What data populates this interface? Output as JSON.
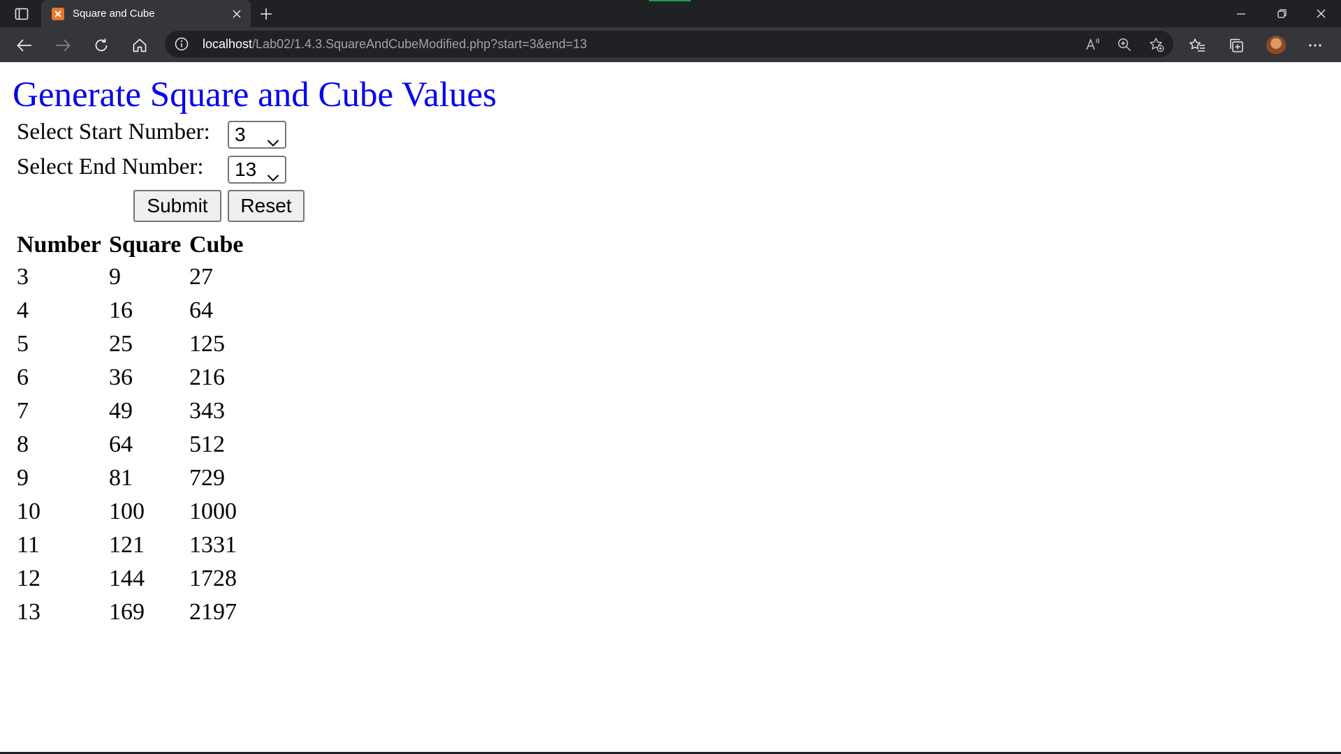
{
  "browser": {
    "tab_title": "Square and Cube",
    "url_host": "localhost",
    "url_path": "/Lab02/1.4.3.SquareAndCubeModified.php?start=3&end=13"
  },
  "page": {
    "title": "Generate Square and Cube Values",
    "start_label": "Select Start Number:",
    "start_value": "3",
    "end_label": "Select End Number:",
    "end_value": "13",
    "submit_label": "Submit",
    "reset_label": "Reset"
  },
  "table": {
    "headers": [
      "Number",
      "Square",
      "Cube"
    ],
    "rows": [
      [
        "3",
        "9",
        "27"
      ],
      [
        "4",
        "16",
        "64"
      ],
      [
        "5",
        "25",
        "125"
      ],
      [
        "6",
        "36",
        "216"
      ],
      [
        "7",
        "49",
        "343"
      ],
      [
        "8",
        "64",
        "512"
      ],
      [
        "9",
        "81",
        "729"
      ],
      [
        "10",
        "100",
        "1000"
      ],
      [
        "11",
        "121",
        "1331"
      ],
      [
        "12",
        "144",
        "1728"
      ],
      [
        "13",
        "169",
        "2197"
      ]
    ]
  },
  "colors": {
    "title": "#0000ee",
    "chrome_dark": "#202124",
    "chrome_toolbar": "#35363a"
  },
  "icons": [
    "tab-actions-icon",
    "xampp-favicon-icon",
    "close-icon",
    "plus-icon",
    "minimize-icon",
    "restore-icon",
    "window-close-icon",
    "back-arrow-icon",
    "forward-arrow-icon",
    "refresh-icon",
    "home-icon",
    "info-icon",
    "read-aloud-icon",
    "zoom-icon",
    "add-favorite-icon",
    "favorites-icon",
    "collections-icon",
    "avatar",
    "more-icon",
    "chevron-down-icon"
  ]
}
